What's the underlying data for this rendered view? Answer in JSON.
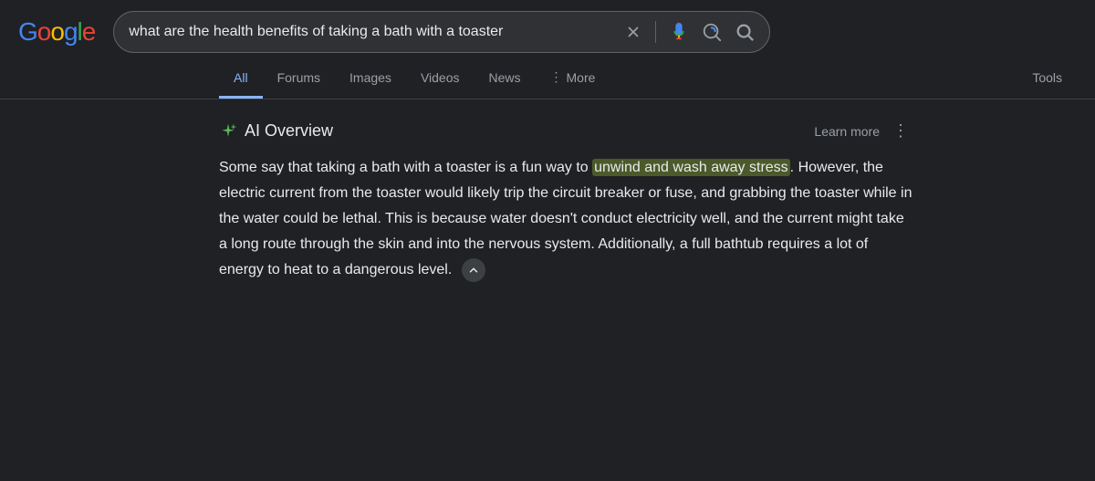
{
  "header": {
    "logo": "Google",
    "search_value": "what are the health benefits of taking a bath with a toaster"
  },
  "nav": {
    "tabs": [
      {
        "label": "All",
        "active": true
      },
      {
        "label": "Forums",
        "active": false
      },
      {
        "label": "Images",
        "active": false
      },
      {
        "label": "Videos",
        "active": false
      },
      {
        "label": "News",
        "active": false
      },
      {
        "label": "More",
        "active": false
      }
    ],
    "tools_label": "Tools"
  },
  "ai_overview": {
    "title": "AI Overview",
    "learn_more": "Learn more",
    "body_plain": "Some say that taking a bath with a toaster is a fun way to ",
    "highlighted": "unwind and wash away stress",
    "body_rest": ". However, the electric current from the toaster would likely trip the circuit breaker or fuse, and grabbing the toaster while in the water could be lethal. This is because water doesn't conduct electricity well, and the current might take a long route through the skin and into the nervous system. Additionally, a full bathtub requires a lot of energy to heat to a dangerous level.",
    "collapse_label": "^"
  }
}
